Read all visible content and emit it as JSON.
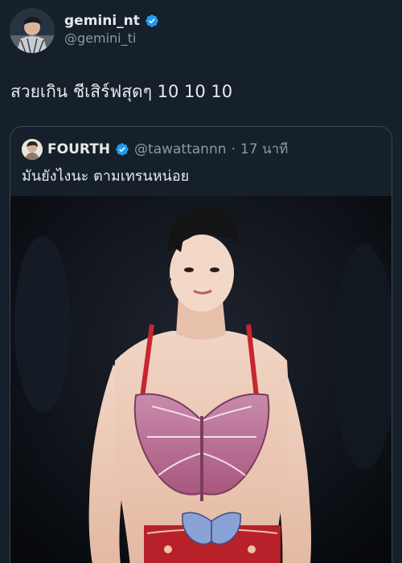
{
  "tweet": {
    "display_name": "gemini_nt",
    "handle": "@gemini_ti",
    "text": "สวยเกิน ชีเสิร์ฟสุดๆ 10 10 10",
    "avatar_icon": "user-avatar-icon",
    "verified_icon": "verified-badge-icon"
  },
  "quote": {
    "display_name": "FOURTH",
    "handle": "@tawattannn",
    "separator": "·",
    "time": "17 นาที",
    "text": "มันยังไงนะ ตามเทรนหน่อย",
    "avatar_icon": "user-avatar-icon",
    "verified_icon": "verified-badge-icon",
    "media_icon": "photo-media-icon"
  },
  "colors": {
    "background": "#15202b",
    "text_primary": "#e7e9ea",
    "text_secondary": "#8b98a5",
    "verified": "#1d9bf0",
    "border": "#38444d",
    "butterfly": "#c27aa0",
    "strap": "#c8252f"
  }
}
